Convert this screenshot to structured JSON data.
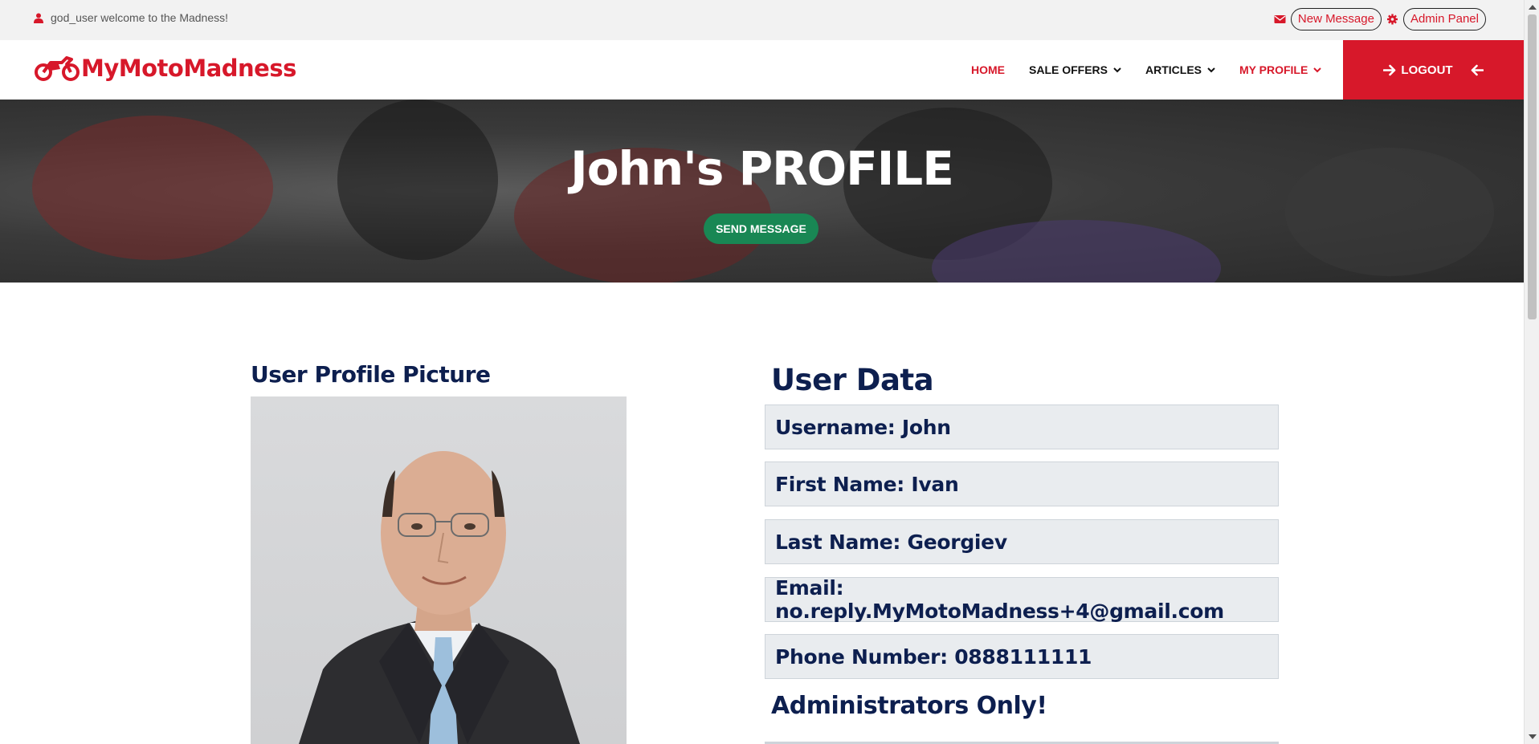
{
  "topbar": {
    "welcome_text": "god_user welcome to the Madness!",
    "new_message_label": "New Message",
    "admin_panel_label": "Admin Panel"
  },
  "header": {
    "logo_text": "MyMotoMadness",
    "nav": [
      {
        "label": "HOME",
        "active": true,
        "dropdown": false
      },
      {
        "label": "SALE OFFERS",
        "active": false,
        "dropdown": true
      },
      {
        "label": "ARTICLES",
        "active": false,
        "dropdown": true
      },
      {
        "label": "MY PROFILE",
        "active": true,
        "dropdown": true
      }
    ],
    "logout_label": "LOGOUT"
  },
  "banner": {
    "title": "John's PROFILE",
    "send_message_label": "SEND MESSAGE"
  },
  "profile": {
    "picture_title": "User Profile Picture",
    "data_title": "User Data",
    "fields": [
      {
        "label": "Username: John"
      },
      {
        "label": "First Name: Ivan"
      },
      {
        "label": "Last Name: Georgiev"
      },
      {
        "label": "Email: no.reply.MyMotoMadness+4@gmail.com"
      },
      {
        "label": "Phone Number: 0888111111"
      }
    ],
    "admin_title": "Administrators Only!"
  },
  "colors": {
    "brand_red": "#d7182a",
    "navy": "#0d1f4f",
    "green_button": "#198754",
    "field_bg": "#e9ecef"
  },
  "icons": [
    "user-icon",
    "envelope-icon",
    "gear-icon",
    "motorcycle-logo-icon",
    "chevron-down-icon",
    "arrow-right-icon",
    "arrow-left-icon"
  ]
}
